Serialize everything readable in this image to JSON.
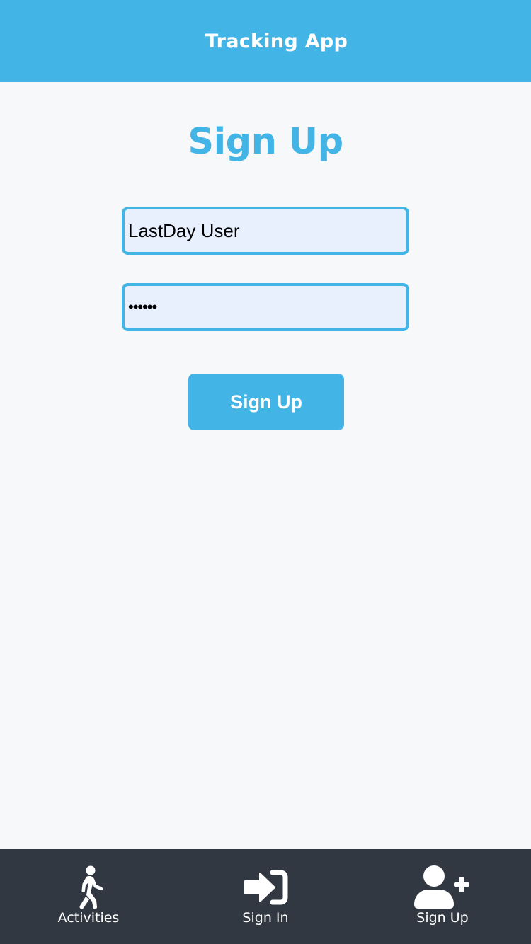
{
  "header": {
    "title": "Tracking App"
  },
  "form": {
    "heading": "Sign Up",
    "username": {
      "value": "LastDay User"
    },
    "password": {
      "value": "••••••"
    },
    "submit_label": "Sign Up"
  },
  "tabbar": {
    "tabs": [
      {
        "label": "Activities",
        "icon": "walking-person-icon"
      },
      {
        "label": "Sign In",
        "icon": "sign-in-icon"
      },
      {
        "label": "Sign Up",
        "icon": "user-plus-icon"
      }
    ]
  },
  "colors": {
    "accent": "#42b4e6",
    "tabbar_background": "#323842",
    "background": "#f6f8f9",
    "field_fill": "#e8f0fe"
  }
}
